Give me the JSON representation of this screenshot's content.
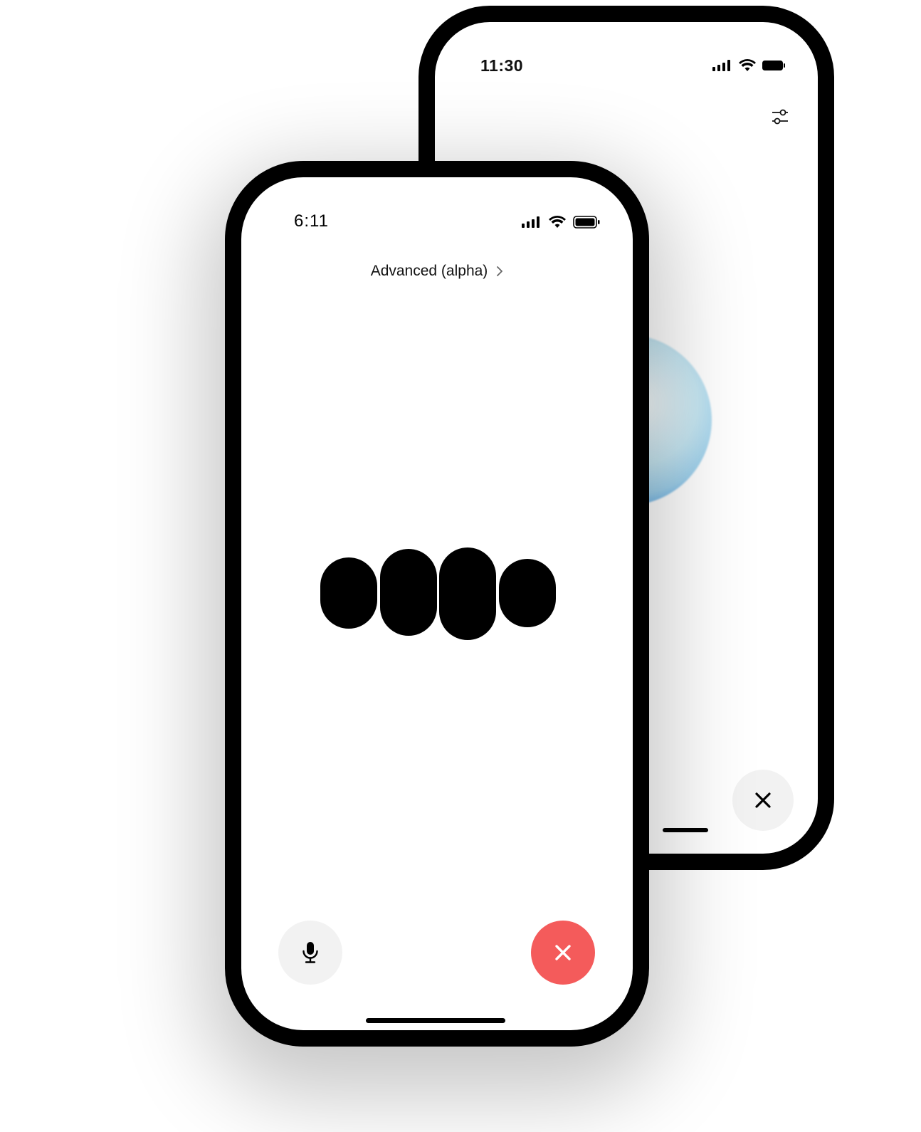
{
  "back_phone": {
    "status_bar": {
      "time": "11:30",
      "icons": [
        "cellular-signal-icon",
        "wifi-icon",
        "battery-icon"
      ]
    },
    "settings_icon": "sliders-icon",
    "close_icon": "close-icon",
    "orb_colors": [
      "#ffffff",
      "#dcf0f7",
      "#96cdeb",
      "#1e78e1"
    ]
  },
  "front_phone": {
    "status_bar": {
      "time": "6:11",
      "icons": [
        "cellular-signal-icon",
        "wifi-icon",
        "battery-icon"
      ]
    },
    "mode_selector": {
      "label": "Advanced (alpha)",
      "icon": "chevron-right-icon"
    },
    "voice_indicator_icon": "voice-activity-bars-icon",
    "mic_button_icon": "microphone-icon",
    "end_button_icon": "close-icon",
    "end_button_color": "#f45b5b"
  }
}
